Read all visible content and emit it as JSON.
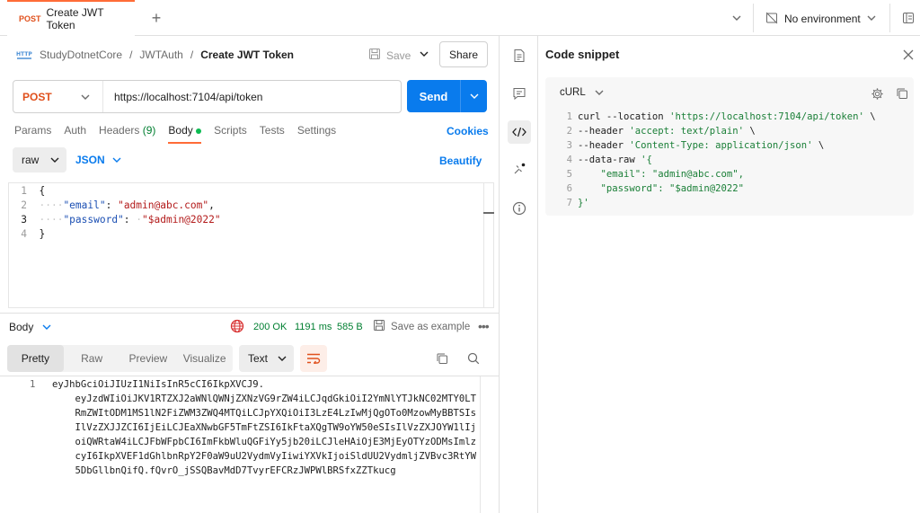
{
  "tab": {
    "method": "POST",
    "name": "Create JWT Token"
  },
  "environment": {
    "label": "No environment"
  },
  "breadcrumb": {
    "root": "StudyDotnetCore",
    "folder": "JWTAuth",
    "current": "Create JWT Token",
    "sep": "/"
  },
  "actions": {
    "save": "Save",
    "share": "Share"
  },
  "request": {
    "method": "POST",
    "url": "https://localhost:7104/api/token",
    "send": "Send"
  },
  "req_tabs": {
    "params": "Params",
    "auth": "Auth",
    "headers": "Headers",
    "headers_count": "(9)",
    "body": "Body",
    "scripts": "Scripts",
    "tests": "Tests",
    "settings": "Settings",
    "cookies": "Cookies"
  },
  "body_opts": {
    "raw": "raw",
    "json": "JSON",
    "beautify": "Beautify"
  },
  "body_code": {
    "l1": {
      "num": "1",
      "text": "{"
    },
    "l2": {
      "num": "2",
      "dots": "····",
      "key": "\"email\"",
      "colon": ": ",
      "val": "\"admin@abc.com\"",
      "tail": ","
    },
    "l3": {
      "num": "3",
      "dots": "····",
      "key": "\"password\"",
      "colon": ": ",
      "dot2": "·",
      "val": "\"$admin@2022\""
    },
    "l4": {
      "num": "4",
      "text": "}"
    }
  },
  "response": {
    "label": "Body",
    "status": "200 OK",
    "time": "1191 ms",
    "size": "585 B",
    "save_example": "Save as example",
    "views": [
      "Pretty",
      "Raw",
      "Preview",
      "Visualize"
    ],
    "format": "Text",
    "line_num": "1",
    "lines": [
      "eyJhbGciOiJIUzI1NiIsInR5cCI6IkpXVCJ9.",
      "    eyJzdWIiOiJKV1RTZXJ2aWNlQWNjZXNzVG9rZW4iLCJqdGkiOiI2YmNlYTJkNC02MTY0LT",
      "    RmZWItODM1MS1lN2FiZWM3ZWQ4MTQiLCJpYXQiOiI3LzE4LzIwMjQgOTo0MzowMyBBTSIs",
      "    IlVzZXJJZCI6IjEiLCJEaXNwbGF5TmFtZSI6IkFtaXQgTW9oYW50eSIsIlVzZXJOYW1lIj",
      "    oiQWRtaW4iLCJFbWFpbCI6ImFkbWluQGFiYy5jb20iLCJleHAiOjE3MjEyOTYzODMsImlz",
      "    cyI6IkpXVEF1dGhlbnRpY2F0aW9uU2VydmVyIiwiYXVkIjoiSldUU2VydmljZVBvc3RtYW",
      "    5DbGllbnQifQ.fQvrO_jSSQBavMdD7TvyrEFCRzJWPWlBRSfxZZTkucg"
    ]
  },
  "snippet": {
    "title": "Code snippet",
    "lang": "cURL",
    "lines": [
      {
        "n": "1",
        "a": "curl --location ",
        "s": "'https://localhost:7104/api/token'",
        "b": " \\"
      },
      {
        "n": "2",
        "a": "--header ",
        "s": "'accept: text/plain'",
        "b": " \\"
      },
      {
        "n": "3",
        "a": "--header ",
        "s": "'Content-Type: application/json'",
        "b": " \\"
      },
      {
        "n": "4",
        "a": "--data-raw ",
        "s": "'{",
        "b": ""
      },
      {
        "n": "5",
        "a": "    ",
        "s": "\"email\": \"admin@abc.com\",",
        "b": ""
      },
      {
        "n": "6",
        "a": "    ",
        "s": "\"password\": \"$admin@2022\"",
        "b": ""
      },
      {
        "n": "7",
        "a": "",
        "s": "}'",
        "b": ""
      }
    ]
  },
  "colors": {
    "accent": "#ff6c37",
    "primary": "#097bed",
    "post": "#e0501c",
    "ok": "#007f31"
  }
}
